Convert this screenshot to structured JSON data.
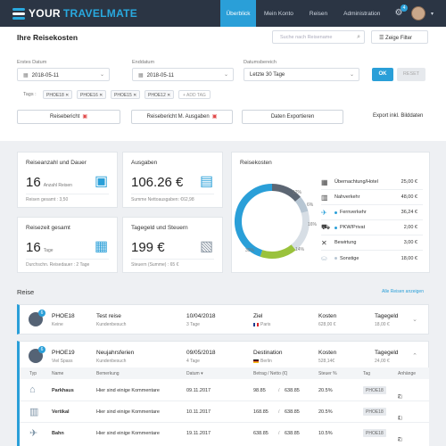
{
  "app": {
    "logo_your": "YOUR",
    "logo_brand": "TRAVELMATE"
  },
  "nav": {
    "items": [
      "Überblick",
      "Mein Konto",
      "Reisen",
      "Administration"
    ],
    "notif_count": "4"
  },
  "page": {
    "title": "Ihre Reisekosten",
    "search_placeholder": "Suche nach Reisename",
    "filter_btn": "Zeige Filter"
  },
  "filters": {
    "start_label": "Erstes Datum",
    "start_value": "2018-05-11",
    "end_label": "Enddatum",
    "end_value": "2018-05-11",
    "range_label": "Datumsbereich",
    "range_value": "Letzte 30 Tage",
    "ok": "OK",
    "reset": "RESET",
    "tags_label": "Tags :",
    "tags": [
      "PHOE18",
      "PHOE16",
      "PHOE15",
      "PHOE12"
    ],
    "add_tag": "+ ADD TAG",
    "btn_report": "Reisebericht",
    "btn_report_exp": "Reisebericht M. Ausgaben",
    "btn_export": "Daten Exportieren",
    "btn_export_img": "Export inkl. Bilddaten"
  },
  "cards": {
    "trips": {
      "title": "Reiseanzahl und Dauer",
      "value": "16",
      "unit": "Anzahl Reisen",
      "sub": "Reisen gesamt : 3,50"
    },
    "expenses": {
      "title": "Ausgaben",
      "value": "106.26 €",
      "sub": "Summe Nettoausgaben: €62,98"
    },
    "time": {
      "title": "Reisezeit gesamt",
      "value": "16",
      "unit": "Tage",
      "sub": "Durchschn. Reisedauer : 2 Tage"
    },
    "allowance": {
      "title": "Tagegeld und Steuern",
      "value": "199 €",
      "sub": "Steuern (Summe) : 65 €"
    }
  },
  "reisekosten": {
    "title": "Reisekosten",
    "legend": [
      {
        "label": "Übernachtung/Hotel",
        "value": "25,00 €",
        "icon": "hotel-icon",
        "color": "#555f6b"
      },
      {
        "label": "Nahverkehr",
        "value": "48,00 €",
        "icon": "city-icon",
        "color": "#555f6b"
      },
      {
        "label": "Fernverkehr",
        "value": "36,24 €",
        "icon": "plane-icon",
        "color": "#2a9fd8"
      },
      {
        "label": "PKW/Privat",
        "value": "2,00 €",
        "icon": "car-icon",
        "color": "#2a9fd8"
      },
      {
        "label": "Bewirtung",
        "value": "3,00 €",
        "icon": "cutlery-icon",
        "color": "#b7c6d3"
      },
      {
        "label": "Sonstige",
        "value": "18,00 €",
        "icon": "misc-icon",
        "color": "#b7c6d3"
      }
    ],
    "donut_labels": [
      "12%",
      "6%",
      "16%",
      "14%",
      "39%"
    ]
  },
  "chart_data": {
    "type": "pie",
    "values": [
      12,
      6,
      16,
      14,
      39
    ],
    "labels": [
      "12%",
      "6%",
      "16%",
      "14%",
      "39%"
    ],
    "colors": [
      "#5c6673",
      "#b7c6d3",
      "#d7dee5",
      "#9ac23c",
      "#2a9fd8"
    ]
  },
  "reise": {
    "title": "Reise",
    "all_link": "Alle Reisen anzeigen",
    "trips": [
      {
        "code": "PHOE18",
        "sub": "Keine",
        "name": "Test reise",
        "name_sub": "Kundenbesuch",
        "date": "10/04/2018",
        "days": "3 Tage",
        "dest_lbl": "Ziel",
        "dest": "Paris",
        "cost_lbl": "Kosten",
        "cost": "628,00 €",
        "allow_lbl": "Tagegeld",
        "allow": "18,00 €",
        "count": "6"
      },
      {
        "code": "PHOE19",
        "sub": "Viel Spass",
        "name": "Neujahrsferien",
        "name_sub": "Kundenbesuch",
        "date": "09/05/2018",
        "days": "4 Tage",
        "dest_lbl": "Destination",
        "dest": "Berlin",
        "cost_lbl": "Kosten",
        "cost": "528,14€",
        "allow_lbl": "Tagegeld",
        "allow": "24,00 €",
        "count": "6"
      }
    ]
  },
  "detail": {
    "headers": [
      "Typ",
      "Name",
      "Bemerkung",
      "Datum",
      "Betrag / Netto (€)",
      "Steuer %",
      "Tag",
      "Anhänge"
    ],
    "rows": [
      {
        "name": "Parkhaus",
        "note": "Hier sind einige Kommentare",
        "date": "09.11.2017",
        "amount": "98.85",
        "net": "638.85",
        "tax": "20.5%",
        "tag": "PHOE18",
        "att": "2"
      },
      {
        "name": "Vertikal",
        "note": "Hier sind einige Kommentare",
        "date": "10.11.2017",
        "amount": "168.85",
        "net": "638.85",
        "tax": "20.5%",
        "tag": "PHOE18",
        "att": "1"
      },
      {
        "name": "Bahn",
        "note": "Hier sind einige Kommentare",
        "date": "19.11.2017",
        "amount": "638.85",
        "net": "638.85",
        "tax": "10.5%",
        "tag": "PHOE18",
        "att": "2"
      }
    ]
  }
}
